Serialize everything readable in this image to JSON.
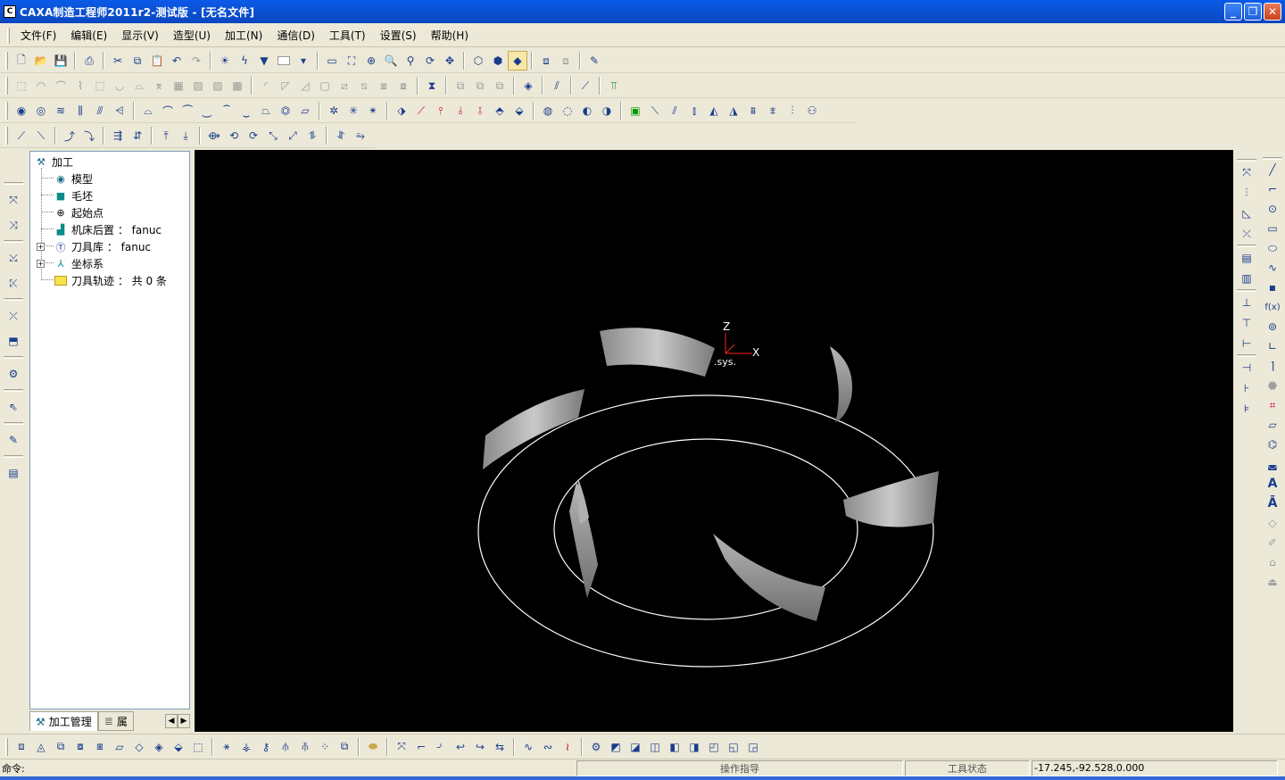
{
  "window": {
    "title": "CAXA制造工程师2011r2-测试版   - [无名文件]",
    "app_icon": "CAXA"
  },
  "menu": [
    "文件(F)",
    "编辑(E)",
    "显示(V)",
    "造型(U)",
    "加工(N)",
    "通信(D)",
    "工具(T)",
    "设置(S)",
    "帮助(H)"
  ],
  "tree": {
    "root": "加工",
    "items": [
      {
        "label": "模型"
      },
      {
        "label": "毛坯"
      },
      {
        "label": "起始点"
      },
      {
        "label": "机床后置 ： fanuc"
      },
      {
        "label": "刀具库 ： fanuc"
      },
      {
        "label": "坐标系"
      },
      {
        "label": "刀具轨迹 ： 共 0 条"
      }
    ]
  },
  "panel_tabs": {
    "tab1": "加工管理",
    "tab2": "属"
  },
  "viewport": {
    "axis_z": "Z",
    "axis_x": "X",
    "axis_label": ".sys."
  },
  "status": {
    "command_label": "命令:",
    "hint_label": "操作指导",
    "tool_state": "工具状态",
    "coords": "-17.245,-92.528,0.000"
  },
  "colors": {
    "title_bar": "#0b4fcf",
    "viewport_bg": "#000000",
    "chrome": "#ece9d8"
  }
}
